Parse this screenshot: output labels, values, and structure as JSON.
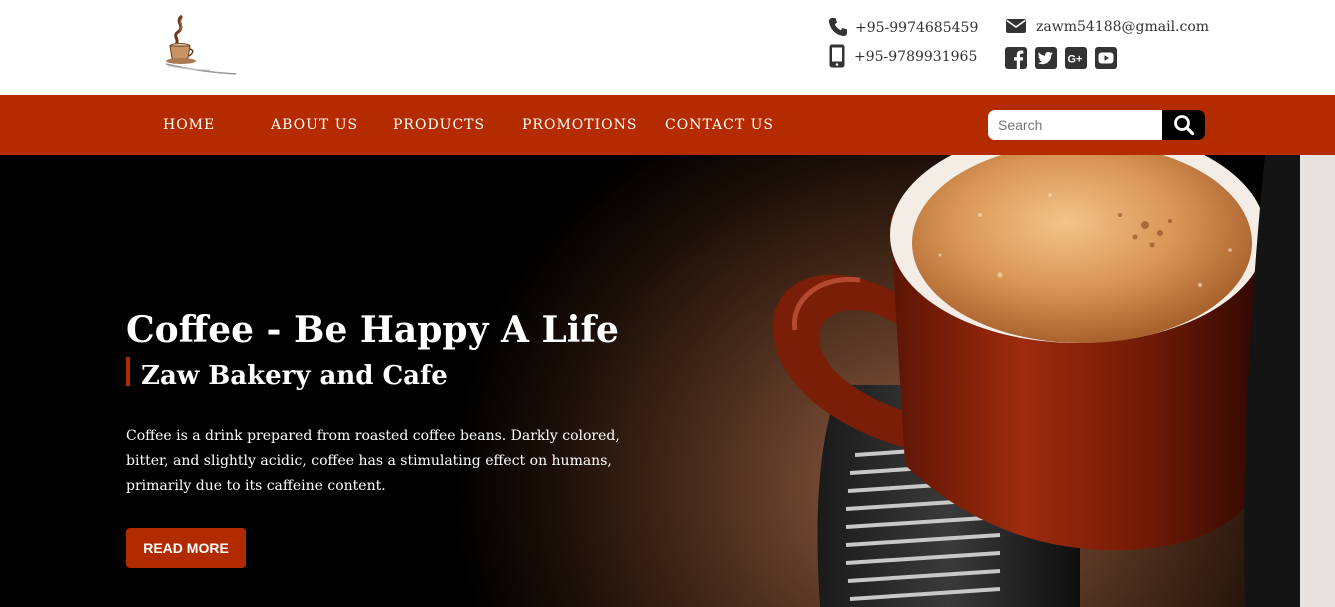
{
  "brand": {
    "logo_icon": "coffee-cup-logo-icon"
  },
  "colors": {
    "accent": "#b22b00",
    "nav_bg": "#b52b00",
    "button_bg": "#b22b00",
    "search_button_bg": "#000000"
  },
  "contact": {
    "phone1": "+95-9974685459",
    "phone1_icon": "phone-icon",
    "phone2": "+95-9789931965",
    "phone2_icon": "mobile-phone-icon",
    "email": "zawm54188@gmail.com",
    "email_icon": "envelope-icon"
  },
  "social": [
    "facebook-icon",
    "twitter-icon",
    "google-plus-icon",
    "youtube-icon"
  ],
  "nav": {
    "items": [
      {
        "label": "HOME"
      },
      {
        "label": "ABOUT US"
      },
      {
        "label": "PRODUCTS"
      },
      {
        "label": "PROMOTIONS"
      },
      {
        "label": "CONTACT US"
      }
    ]
  },
  "search": {
    "placeholder": "Search",
    "value": "",
    "icon": "search-icon"
  },
  "hero": {
    "title": "Coffee - Be Happy A Life",
    "subtitle": "Zaw Bakery and Cafe",
    "description": "Coffee is a drink prepared from roasted coffee beans. Darkly colored, bitter, and slightly acidic, coffee has a stimulating effect on humans, primarily due to its caffeine content.",
    "button_label": "READ MORE",
    "image": "coffee-cup-photo"
  }
}
